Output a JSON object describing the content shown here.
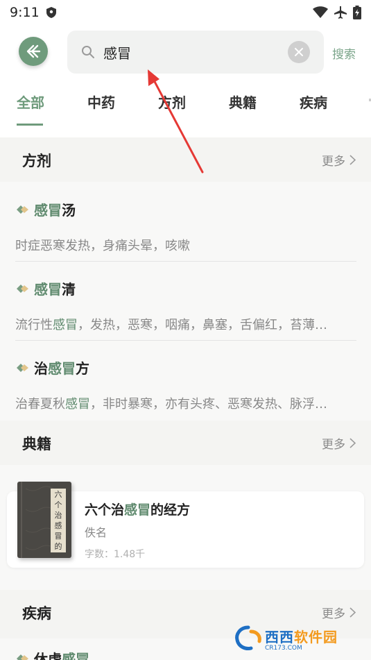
{
  "status_bar": {
    "time": "9:11"
  },
  "search": {
    "value": "感冒",
    "button_label": "搜索"
  },
  "tabs": [
    "全部",
    "中药",
    "方剂",
    "典籍",
    "疾病"
  ],
  "sections": {
    "fangji": {
      "title": "方剂",
      "more": "更多"
    },
    "dianji": {
      "title": "典籍",
      "more": "更多"
    },
    "jibing": {
      "title": "疾病",
      "more": "更多"
    }
  },
  "recipes": [
    {
      "pre": "",
      "hl": "感冒",
      "post": "汤",
      "desc_pre": "时症恶寒发热，身痛头晕，咳嗽",
      "desc_hl": "",
      "desc_post": ""
    },
    {
      "pre": "",
      "hl": "感冒",
      "post": "清",
      "desc_pre": "流行性",
      "desc_hl": "感冒",
      "desc_post": "，发热，恶寒，咽痛，鼻塞，舌偏红，苔薄…"
    },
    {
      "pre": "治",
      "hl": "感冒",
      "post": "方",
      "desc_pre": "治春夏秋",
      "desc_hl": "感冒",
      "desc_post": "，非时暴寒，亦有头疼、恶寒发热、脉浮…"
    }
  ],
  "book": {
    "cover_text": [
      "六",
      "个",
      "治",
      "感",
      "冒",
      "的"
    ],
    "title_pre": "六个治",
    "title_hl": "感冒",
    "title_post": "的经方",
    "author": "佚名",
    "word_count": "字数：1.48千"
  },
  "disease_preview": {
    "pre": "休虚",
    "hl": "感冒"
  },
  "watermark": {
    "main_a": "西西",
    "main_b": "软件园",
    "sub": "CR173.COM"
  },
  "colors": {
    "accent": "#6f9b7c",
    "highlight": "#5f8a6e",
    "arrow": "#e53935"
  }
}
